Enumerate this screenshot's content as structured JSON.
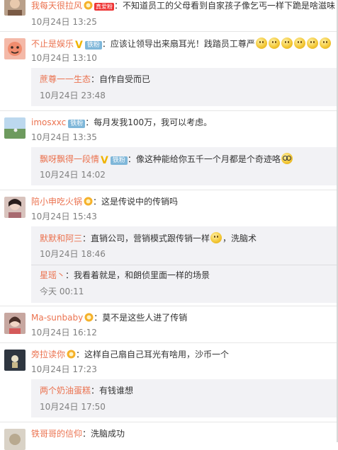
{
  "comments": [
    {
      "name": "我每天很拉风",
      "vip_badge": "真爱粉",
      "text": "：不知道员工的父母看到自家孩子像乞丐一样下跪是啥滋味",
      "time": "10月24日 13:25"
    },
    {
      "name": "不止是娱乐",
      "fan_badge": "铁粉",
      "text": "：应该让领导出来扇耳光！践踏员工尊严",
      "time": "10月24日 13:10",
      "emoji_count": 6,
      "replies": [
        {
          "name": "蔗尊一一生态",
          "text": "：自作自受而已",
          "time": "10月24日 23:48"
        }
      ]
    },
    {
      "name": "imosxxc",
      "fan_badge": "铁粉",
      "text": "：每月发我100万，我可以考虑。",
      "time": "10月24日 13:35",
      "replies": [
        {
          "name": "飘呀飘得一段情",
          "fan_badge": "铁粉",
          "text": "：像这种能给你五千一个月都是个奇迹咯",
          "time": "10月24日 14:02"
        }
      ]
    },
    {
      "name": "陪小申吃火锅",
      "text": "：这是传说中的传销吗",
      "time": "10月24日 15:43",
      "replies": [
        {
          "name": "默默和阿三",
          "text": "：直销公司，营销模式跟传销一样",
          "text2": "，洗脑术",
          "time": "10月24日 18:46"
        },
        {
          "name": "星瑶丶",
          "text": "：我看着就是，和朗侦里面一样的场景",
          "time": "今天 00:11"
        }
      ]
    },
    {
      "name": "Ma-sunbaby",
      "text": "：莫不是这些人进了传销",
      "time": "10月24日 16:12"
    },
    {
      "name": "旁拉读你",
      "text": "：这样自己扇自己耳光有啥用，沙币一个",
      "time": "10月24日 17:23",
      "replies": [
        {
          "name": "两个奶油蛋糕",
          "text": "：有钱谁想",
          "time": "10月24日 17:50"
        }
      ]
    },
    {
      "name": "铁哥哥的信仰",
      "text": "：洗脑成功"
    }
  ],
  "colors": {
    "name": "#eb7350",
    "reply_bg": "#f2f2f5",
    "time": "#808080"
  }
}
